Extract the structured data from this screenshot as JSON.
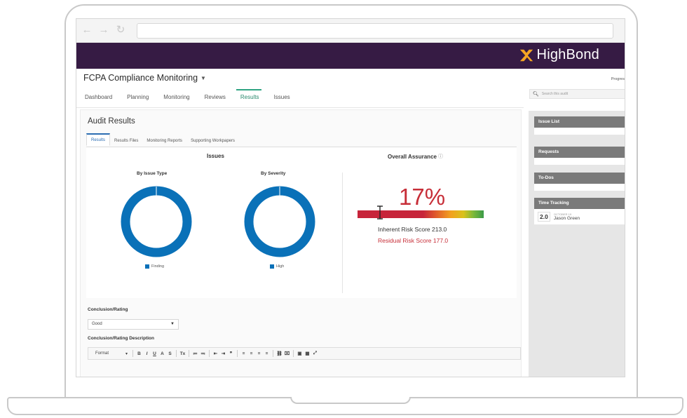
{
  "brand": {
    "name": "HighBond",
    "header_color": "#361b44",
    "accent": "#f5a623"
  },
  "browser": {
    "back_icon": "arrow-left-icon",
    "forward_icon": "arrow-right-icon",
    "reload_icon": "reload-icon",
    "url": ""
  },
  "page": {
    "title": "FCPA Compliance Monitoring"
  },
  "main_tabs": [
    {
      "label": "Dashboard",
      "active": false
    },
    {
      "label": "Planning",
      "active": false
    },
    {
      "label": "Monitoring",
      "active": false
    },
    {
      "label": "Reviews",
      "active": false
    },
    {
      "label": "Results",
      "active": true
    },
    {
      "label": "Issues",
      "active": false
    }
  ],
  "audit": {
    "title": "Audit Results"
  },
  "sub_tabs": [
    {
      "label": "Results",
      "active": true
    },
    {
      "label": "Results Files",
      "active": false
    },
    {
      "label": "Monitoring Reports",
      "active": false
    },
    {
      "label": "Supporting Workpapers",
      "active": false
    }
  ],
  "issues": {
    "title": "Issues",
    "by_type": {
      "label": "By Issue Type",
      "legend": "Finding",
      "share": 1.0
    },
    "by_severity": {
      "label": "By Severity",
      "legend": "High",
      "share": 1.0
    },
    "color": "#0a71b8"
  },
  "assurance": {
    "title": "Overall Assurance",
    "percent": "17%",
    "inherent": "Inherent Risk Score 213.0",
    "residual": "Residual Risk Score 177.0",
    "level": 0.17
  },
  "conclusion": {
    "label": "Conclusion/Rating",
    "value": "Good",
    "description_label": "Conclusion/Rating Description"
  },
  "editor": {
    "format_label": "Format",
    "buttons": [
      "B",
      "I",
      "U",
      "A",
      "S",
      "Tx",
      "≔",
      "≕",
      "⇤",
      "⇥",
      "❞",
      "≡",
      "≡",
      "≡",
      "≡",
      "⛓",
      "⌧",
      "▣",
      "▦",
      "⤢"
    ]
  },
  "right": {
    "progress_label": "Progres",
    "search_placeholder": "Search this audit"
  },
  "sidebar": {
    "issue_list": "Issue List",
    "requests": "Requests",
    "todos": "To-Dos",
    "time_tracking": "Time Tracking",
    "tt_hours": "2.0",
    "tt_date": "OCTOBER 19",
    "tt_name": "Jason Green"
  }
}
